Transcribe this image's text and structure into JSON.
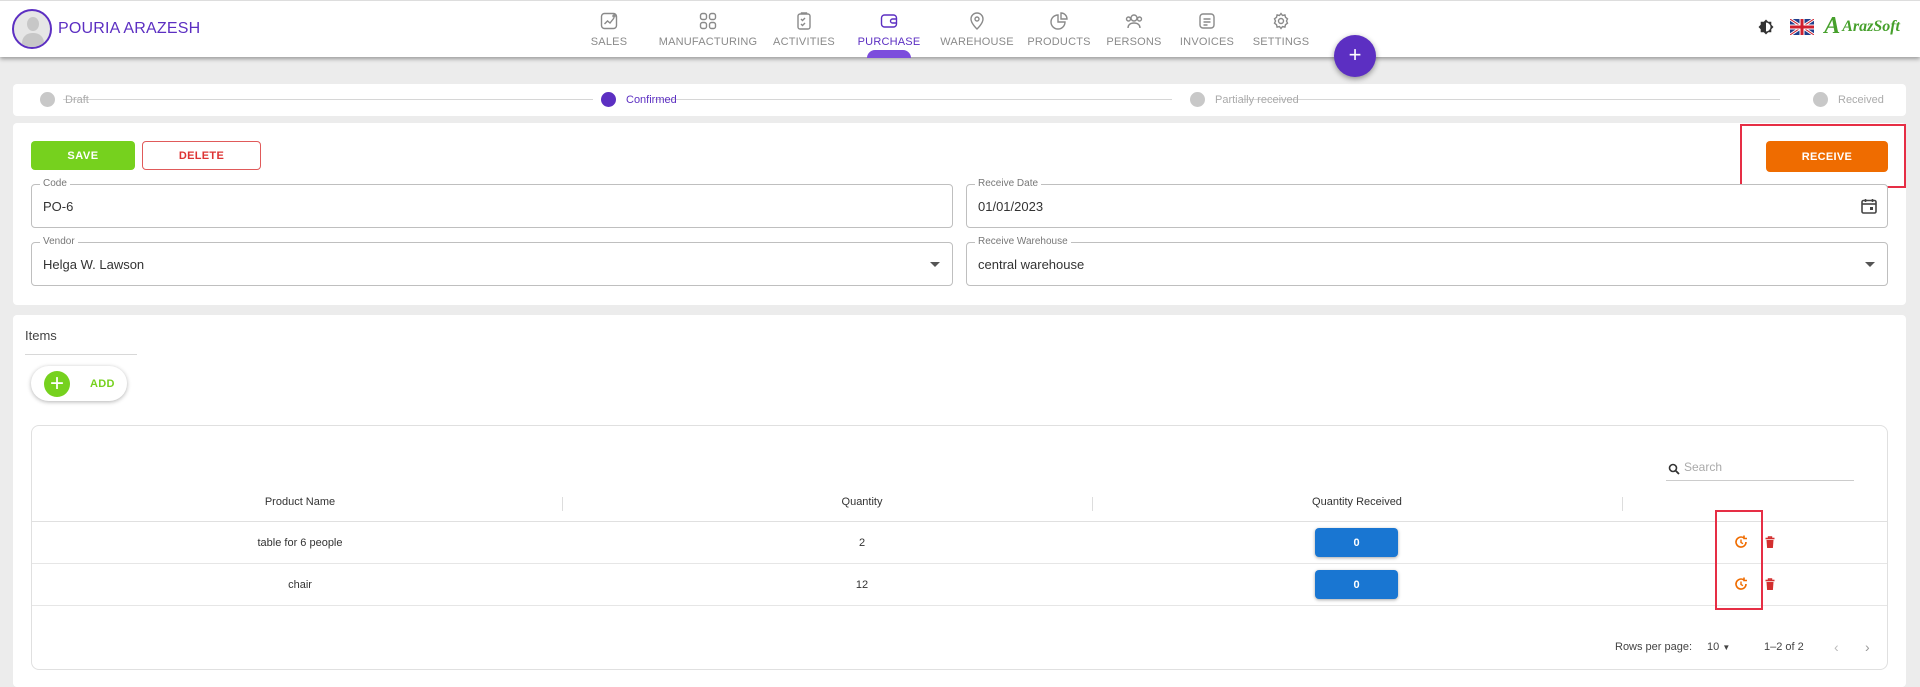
{
  "user": {
    "name": "POURIA ARAZESH"
  },
  "nav": [
    {
      "label": "SALES",
      "icon": "chart-icon",
      "active": false
    },
    {
      "label": "MANUFACTURING",
      "icon": "grid-icon",
      "active": false
    },
    {
      "label": "ACTIVITIES",
      "icon": "clipboard-icon",
      "active": false
    },
    {
      "label": "PURCHASE",
      "icon": "wallet-icon",
      "active": true
    },
    {
      "label": "WAREHOUSE",
      "icon": "location-pin-icon",
      "active": false
    },
    {
      "label": "PRODUCTS",
      "icon": "pie-chart-icon",
      "active": false
    },
    {
      "label": "PERSONS",
      "icon": "people-icon",
      "active": false
    },
    {
      "label": "INVOICES",
      "icon": "document-icon",
      "active": false
    },
    {
      "label": "SETTINGS",
      "icon": "gear-icon",
      "active": false
    }
  ],
  "fab": {
    "label": "+"
  },
  "logo": {
    "text": "ArazSoft"
  },
  "steps": [
    {
      "label": "Draft",
      "active": false
    },
    {
      "label": "Confirmed",
      "active": true
    },
    {
      "label": "Partially received",
      "active": false
    },
    {
      "label": "Received",
      "active": false
    }
  ],
  "actions": {
    "save": "SAVE",
    "delete": "DELETE",
    "receive": "RECEIVE"
  },
  "form": {
    "code": {
      "label": "Code",
      "value": "PO-6"
    },
    "receive_date": {
      "label": "Receive Date",
      "value": "01/01/2023"
    },
    "vendor": {
      "label": "Vendor",
      "value": "Helga W. Lawson"
    },
    "receive_warehouse": {
      "label": "Receive Warehouse",
      "value": "central warehouse"
    }
  },
  "items": {
    "title": "Items",
    "add_label": "ADD",
    "search_placeholder": "Search",
    "columns": [
      "Product Name",
      "Quantity",
      "Quantity Received"
    ],
    "rows": [
      {
        "product": "table for 6 people",
        "quantity": "2",
        "received": "0"
      },
      {
        "product": "chair",
        "quantity": "12",
        "received": "0"
      }
    ],
    "rows_per_page_label": "Rows per page:",
    "rows_per_page": "10",
    "range": "1–2 of 2"
  },
  "colors": {
    "accent": "#5c2fc2",
    "save": "#76d11e",
    "receive": "#ef6c00",
    "primary": "#1976d2",
    "highlight": "#e62e45"
  }
}
